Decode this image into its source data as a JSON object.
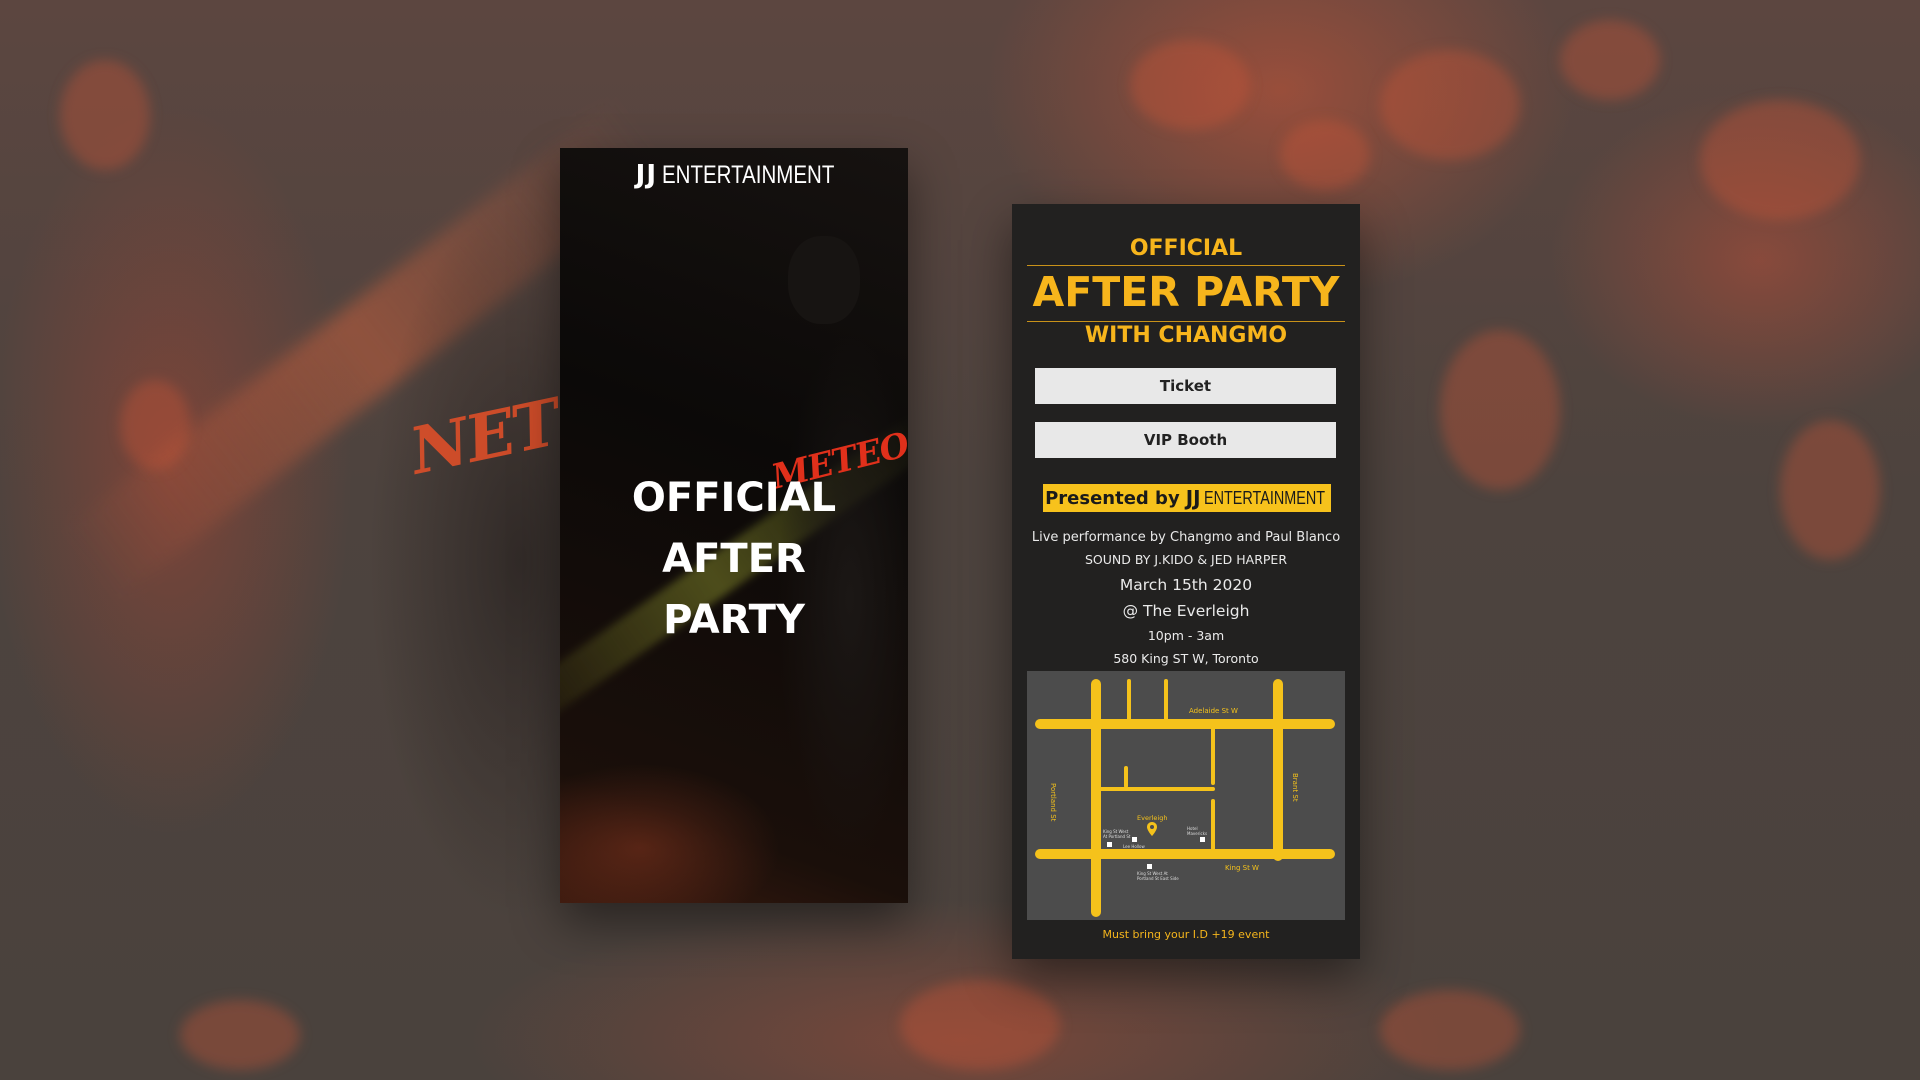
{
  "background": {
    "graffiti_text": "NET"
  },
  "left_flyer": {
    "brand_mark": "JJ",
    "brand_name": "ENTERTAINMENT",
    "jacket_text": "METEOR",
    "title_lines": [
      "OFFICIAL",
      "AFTER",
      "PARTY"
    ]
  },
  "right_flyer": {
    "title_top": "OFFICIAL",
    "title_main": "AFTER PARTY",
    "title_sub": "WITH CHANGMO",
    "buttons": {
      "ticket": "Ticket",
      "vip": "VIP Booth"
    },
    "presented_by": {
      "prefix": "Presented by",
      "mark": "JJ",
      "name": "ENTERTAINMENT"
    },
    "performance": "Live performance by Changmo and Paul Blanco",
    "sound": "SOUND BY J.KIDO & JED HARPER",
    "date": "March 15th 2020",
    "venue": "@ The Everleigh",
    "time": "10pm - 3am",
    "address": "580 King ST W, Toronto",
    "map": {
      "street_adelaide": "Adelaide St W",
      "street_portland": "Portland St",
      "street_brant": "Brant St",
      "street_king": "King St W",
      "venue_label": "Everleigh",
      "stop_1": "King St West At Portland St",
      "stop_2": "Lee Hollow",
      "stop_3": "Hotel Mavericks",
      "stop_4": "King St West At Portland St East Side"
    },
    "footnote": "Must bring your I.D +19 event"
  },
  "colors": {
    "accent": "#f7b51c",
    "panel": "#222120",
    "map_bg": "#4c4c4c"
  }
}
